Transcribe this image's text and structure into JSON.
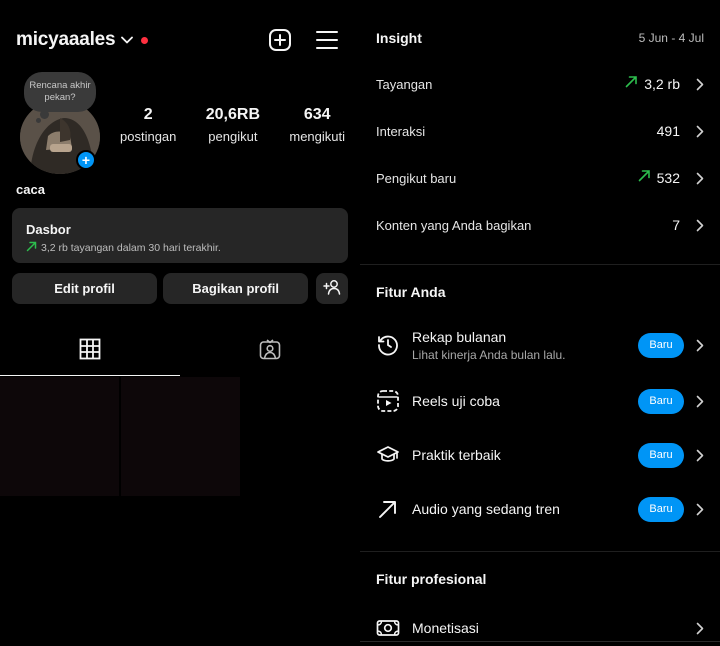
{
  "profile": {
    "username": "micyaaales",
    "note": "Rencana akhir pekan?",
    "display_name": "caca",
    "stats": [
      {
        "num": "2",
        "label": "postingan"
      },
      {
        "num": "20,6RB",
        "label": "pengikut"
      },
      {
        "num": "634",
        "label": "mengikuti"
      }
    ]
  },
  "dashboard": {
    "title": "Dasbor",
    "subtitle": "3,2 rb tayangan dalam 30 hari terakhir."
  },
  "buttons": {
    "edit": "Edit profil",
    "share": "Bagikan profil"
  },
  "insight": {
    "title": "Insight",
    "date_range": "5 Jun - 4 Jul",
    "rows": [
      {
        "label": "Tayangan",
        "value": "3,2 rb",
        "trend": true
      },
      {
        "label": "Interaksi",
        "value": "491",
        "trend": false
      },
      {
        "label": "Pengikut baru",
        "value": "532",
        "trend": true
      },
      {
        "label": "Konten yang Anda bagikan",
        "value": "7",
        "trend": false
      }
    ]
  },
  "fitur": {
    "title": "Fitur Anda",
    "items": [
      {
        "label": "Rekap bulanan",
        "sub": "Lihat kinerja Anda bulan lalu.",
        "badge": "Baru",
        "icon": "history-icon"
      },
      {
        "label": "Reels uji coba",
        "badge": "Baru",
        "icon": "reels-icon"
      },
      {
        "label": "Praktik terbaik",
        "badge": "Baru",
        "icon": "graduation-cap-icon"
      },
      {
        "label": "Audio yang sedang tren",
        "badge": "Baru",
        "icon": "trend-arrow-icon"
      }
    ]
  },
  "profesional": {
    "title": "Fitur profesional",
    "items": [
      {
        "label": "Monetisasi",
        "icon": "money-icon"
      }
    ]
  },
  "colors": {
    "accent": "#0095f6",
    "trend_green": "#2dbe4e",
    "live_dot": "#ff3040"
  }
}
